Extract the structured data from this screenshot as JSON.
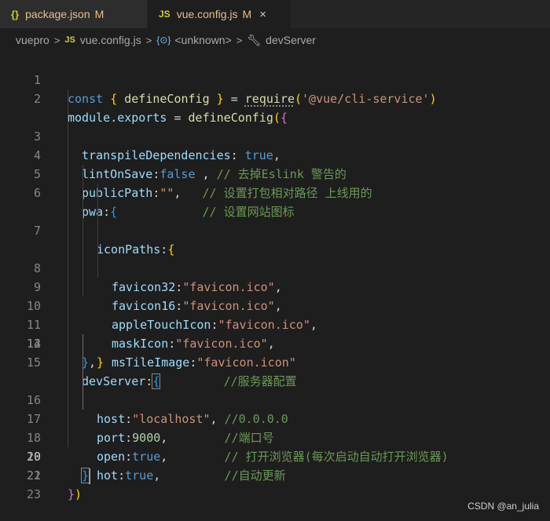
{
  "tabs": [
    {
      "icon": "{}",
      "label": "package.json",
      "modified": "M"
    },
    {
      "icon": "JS",
      "label": "vue.config.js",
      "modified": "M",
      "close": "×"
    }
  ],
  "breadcrumb": {
    "folder": "vuepro",
    "file_icon": "JS",
    "file": "vue.config.js",
    "symbol_icon": "{⊙}",
    "symbol": "<unknown>",
    "leaf": "devServer",
    "separator": ">"
  },
  "editor": {
    "line_numbers": [
      "1",
      "2",
      "3",
      "4",
      "5",
      "6",
      "7",
      "8",
      "9",
      "10",
      "11",
      "12",
      "13",
      "14",
      "15",
      "16",
      "17",
      "18",
      "19",
      "20",
      "21",
      "22",
      "23"
    ],
    "current_line": "20",
    "tokens": {
      "l1": {
        "const": "const",
        "b_open": "{",
        "defineConfig": " defineConfig ",
        "b_close": "}",
        "eq": " = ",
        "require": "require",
        "p_open": "(",
        "str": "'@vue/cli-service'",
        "p_close": ")"
      },
      "l2": {
        "module": "module",
        "dot": ".",
        "exports": "exports",
        "eq": " = ",
        "defineConfig": "defineConfig",
        "p_open": "(",
        "b_open": "{"
      },
      "l3": {
        "key": "transpileDependencies",
        "colon": ": ",
        "val": "true",
        "comma": ","
      },
      "l4": {
        "key": "lintOnSave",
        "colon": ":",
        "val": "false",
        "comma": " ,",
        "comment": " // 去掉Eslink 警告的"
      },
      "l5": {
        "key": "publicPath",
        "colon": ":",
        "val": "\"\"",
        "comma": ",",
        "comment": "   // 设置打包相对路径 上线用的"
      },
      "l6": {
        "key": "pwa",
        "colon": ":",
        "b_open": "{",
        "comment": "            // 设置网站图标"
      },
      "l7": {
        "key": "iconPaths",
        "colon": ":",
        "b_open": "{"
      },
      "l8": {
        "key": "favicon32",
        "colon": ":",
        "val": "\"favicon.ico\"",
        "comma": ","
      },
      "l9": {
        "key": "favicon16",
        "colon": ":",
        "val": "\"favicon.ico\"",
        "comma": ","
      },
      "l10": {
        "key": "appleTouchIcon",
        "colon": ":",
        "val": "\"favicon.ico\"",
        "comma": ","
      },
      "l11": {
        "key": "maskIcon",
        "colon": ":",
        "val": "\"favicon.ico\"",
        "comma": ","
      },
      "l12": {
        "key": "msTileImage",
        "colon": ":",
        "val": "\"favicon.icon\""
      },
      "l13": {
        "b_close": "}"
      },
      "l14": {
        "b_close": "}",
        "comma": ","
      },
      "l15": {
        "key": "devServer",
        "colon": ":",
        "b_open": "{",
        "comment": "         //服务器配置"
      },
      "l16": {
        "key": "host",
        "colon": ":",
        "val": "\"localhost\"",
        "comma": ",",
        "comment": " //0.0.0.0"
      },
      "l17": {
        "key": "port",
        "colon": ":",
        "val": "9000",
        "comma": ",",
        "comment": "        //端口号"
      },
      "l18": {
        "key": "open",
        "colon": ":",
        "val": "true",
        "comma": ",",
        "comment": "        // 打开浏览器(每次启动自动打开浏览器)"
      },
      "l19": {
        "key": "hot",
        "colon": ":",
        "val": "true",
        "comma": ",",
        "comment": "         //自动更新"
      },
      "l20": {
        "b_close": "}"
      },
      "l22": {
        "b_close": "}",
        "p_close": ")"
      }
    }
  },
  "watermark": "CSDN @an_julia",
  "colors": {
    "background": "#1e1e1e",
    "keyword": "#569cd6",
    "function": "#dcdcaa",
    "string": "#ce9178",
    "property": "#9cdcfe",
    "comment": "#6a9955",
    "bracket_level1": "#ffd700",
    "bracket_level2": "#da70d6",
    "bracket_level3": "#179fff",
    "modified": "#e2c08d"
  }
}
